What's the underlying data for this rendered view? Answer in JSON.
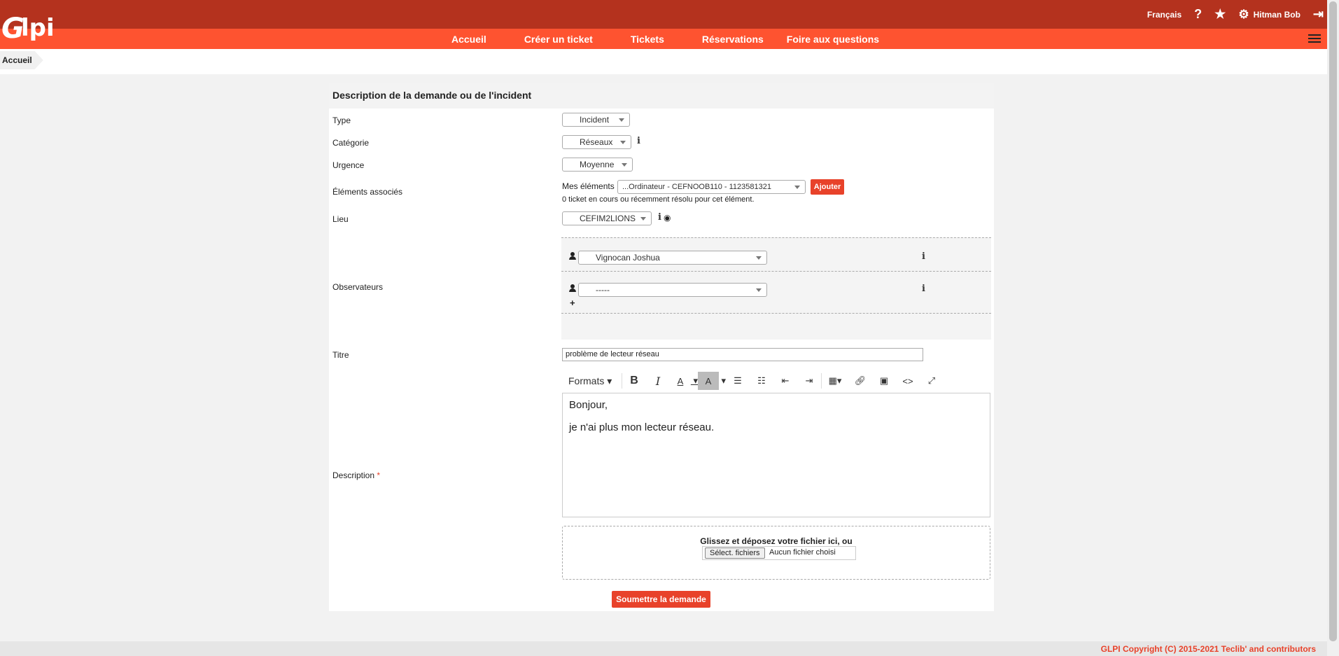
{
  "header": {
    "logo": "Glpi",
    "language": "Français",
    "help_icon": "question-icon",
    "favorites_icon": "star-icon",
    "user_icon": "gear-icon",
    "user_name": "Hitman Bob",
    "logout_icon": "logout-icon"
  },
  "nav": {
    "items": [
      "Accueil",
      "Créer un ticket",
      "Tickets",
      "Réservations",
      "Foire aux questions"
    ],
    "menu_icon": "hamburger-icon"
  },
  "breadcrumb": {
    "current": "Accueil"
  },
  "form": {
    "header": "Description de la demande ou de l'incident",
    "type": {
      "label": "Type",
      "value": "Incident"
    },
    "categorie": {
      "label": "Catégorie",
      "value": "Réseaux"
    },
    "urgence": {
      "label": "Urgence",
      "value": "Moyenne"
    },
    "elements": {
      "label": "Éléments associés",
      "mes_elements": "Mes éléments",
      "value": "...Ordinateur - CEFNOOB110 - 1123581321",
      "add_button": "Ajouter",
      "note": "0 ticket en cours ou récemment résolu pour cet élément."
    },
    "lieu": {
      "label": "Lieu",
      "value": "CEFIM2LIONS"
    },
    "observateurs": {
      "label": "Observateurs",
      "rows": [
        "Vignocan Joshua",
        "-----"
      ],
      "add": "+"
    },
    "titre": {
      "label": "Titre",
      "value": "problème de lecteur réseau"
    },
    "description": {
      "label": "Description",
      "required": "*",
      "toolbar": {
        "formats": "Formats ▾",
        "bold": "B",
        "italic": "I",
        "text_color": "A",
        "bg_color": "A"
      },
      "lines": [
        "Bonjour,",
        "je n'ai plus mon lecteur réseau."
      ]
    },
    "upload": {
      "drop_text": "Glissez et déposez votre fichier ici, ou",
      "button": "Sélect. fichiers",
      "no_file": "Aucun fichier choisi"
    },
    "submit": "Soumettre la demande"
  },
  "footer": {
    "copyright": "GLPI Copyright (C) 2015-2021 Teclib' and contributors"
  },
  "colors": {
    "topbar": "#b4321e",
    "navbar": "#fe5330",
    "accent": "#e8422a"
  }
}
